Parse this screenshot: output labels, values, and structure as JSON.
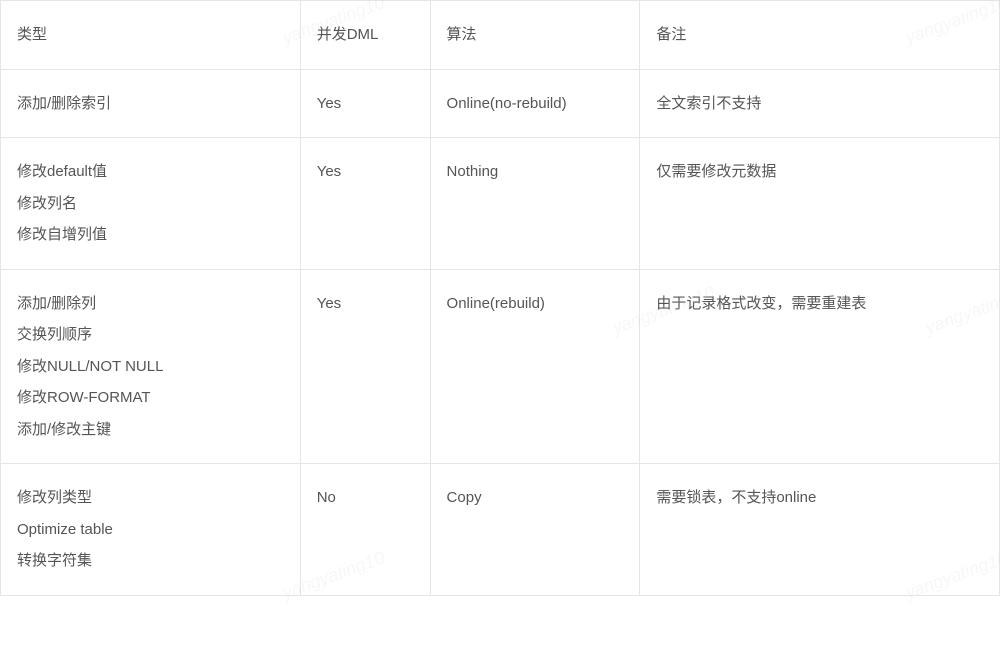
{
  "watermark": "yangyating10",
  "table": {
    "headers": {
      "type": "类型",
      "dml": "并发DML",
      "algo": "算法",
      "note": "备注"
    },
    "rows": [
      {
        "type": [
          "添加/删除索引"
        ],
        "dml": "Yes",
        "algo": "Online(no-rebuild)",
        "note": "全文索引不支持"
      },
      {
        "type": [
          "修改default值",
          "修改列名",
          "修改自增列值"
        ],
        "dml": "Yes",
        "algo": "Nothing",
        "note": "仅需要修改元数据"
      },
      {
        "type": [
          "添加/删除列",
          "交换列顺序",
          "修改NULL/NOT NULL",
          "修改ROW-FORMAT",
          "添加/修改主键"
        ],
        "dml": "Yes",
        "algo": "Online(rebuild)",
        "note": "由于记录格式改变，需要重建表"
      },
      {
        "type": [
          "修改列类型",
          "Optimize table",
          "转换字符集"
        ],
        "dml": "No",
        "algo": "Copy",
        "note": "需要锁表，不支持online"
      }
    ]
  }
}
